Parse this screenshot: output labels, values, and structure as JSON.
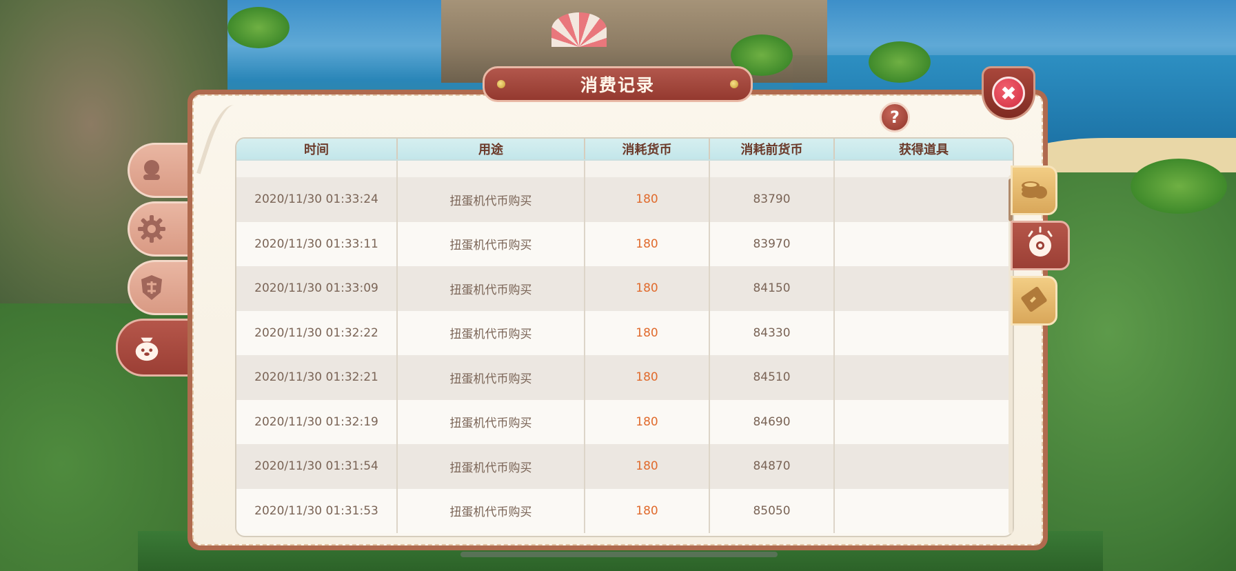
{
  "dialog": {
    "title": "消费记录",
    "help_label": "?",
    "close_label": "✖"
  },
  "table": {
    "headers": [
      "时间",
      "用途",
      "消耗货币",
      "消耗前货币",
      "获得道具"
    ],
    "rows": [
      {
        "time": "2020/11/30 01:33:24",
        "usage": "扭蛋机代币购买",
        "cost": "180",
        "before": "83790",
        "item": ""
      },
      {
        "time": "2020/11/30 01:33:11",
        "usage": "扭蛋机代币购买",
        "cost": "180",
        "before": "83970",
        "item": ""
      },
      {
        "time": "2020/11/30 01:33:09",
        "usage": "扭蛋机代币购买",
        "cost": "180",
        "before": "84150",
        "item": ""
      },
      {
        "time": "2020/11/30 01:32:22",
        "usage": "扭蛋机代币购买",
        "cost": "180",
        "before": "84330",
        "item": ""
      },
      {
        "time": "2020/11/30 01:32:21",
        "usage": "扭蛋机代币购买",
        "cost": "180",
        "before": "84510",
        "item": ""
      },
      {
        "time": "2020/11/30 01:32:19",
        "usage": "扭蛋机代币购买",
        "cost": "180",
        "before": "84690",
        "item": ""
      },
      {
        "time": "2020/11/30 01:31:54",
        "usage": "扭蛋机代币购买",
        "cost": "180",
        "before": "84870",
        "item": ""
      },
      {
        "time": "2020/11/30 01:31:53",
        "usage": "扭蛋机代币购买",
        "cost": "180",
        "before": "85050",
        "item": ""
      }
    ]
  },
  "left_tabs": [
    {
      "icon": "avatar-icon"
    },
    {
      "icon": "gear-icon"
    },
    {
      "icon": "shield-icon"
    },
    {
      "icon": "bag-icon",
      "active": true
    }
  ],
  "right_tabs": [
    {
      "icon": "coins-icon"
    },
    {
      "icon": "gacha-capsule-icon",
      "active": true
    },
    {
      "icon": "ticket-icon"
    }
  ],
  "colors": {
    "accent_red": "#a9473b",
    "cost_orange": "#e06a2c",
    "header_cyan": "#c3e6ea",
    "text_brown": "#7a6456"
  }
}
